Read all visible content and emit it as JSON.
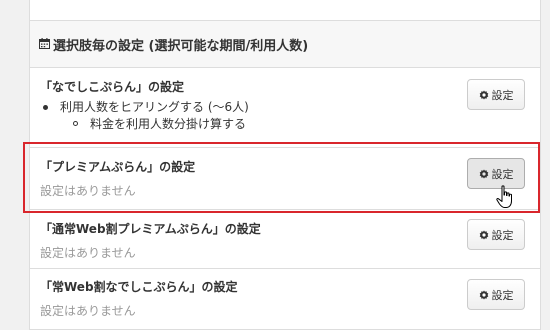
{
  "panel": {
    "title": "選択肢毎の設定 (選択可能な期間/利用人数)",
    "header_icon": "calendar-icon"
  },
  "rows": [
    {
      "title": "「なでしこぷらん」の設定",
      "bullets": [
        {
          "text": "利用人数をヒアリングする (〜6人)",
          "sub": [
            "料金を利用人数分掛け算する"
          ]
        }
      ],
      "empty_text": "",
      "button_label": "設定"
    },
    {
      "title": "「プレミアムぷらん」の設定",
      "empty_text": "設定はありません",
      "button_label": "設定",
      "highlighted": true
    },
    {
      "title": "「通常Web割プレミアムぷらん」の設定",
      "empty_text": "設定はありません",
      "button_label": "設定"
    },
    {
      "title": "「常Web割なでしこぷらん」の設定",
      "empty_text": "設定はありません",
      "button_label": "設定"
    }
  ],
  "colors": {
    "highlight": "#d9262c",
    "border": "#dddddd",
    "muted_text": "#999999"
  },
  "icons": {
    "button": "gear-icon",
    "cursor": "hand-pointer-icon"
  }
}
